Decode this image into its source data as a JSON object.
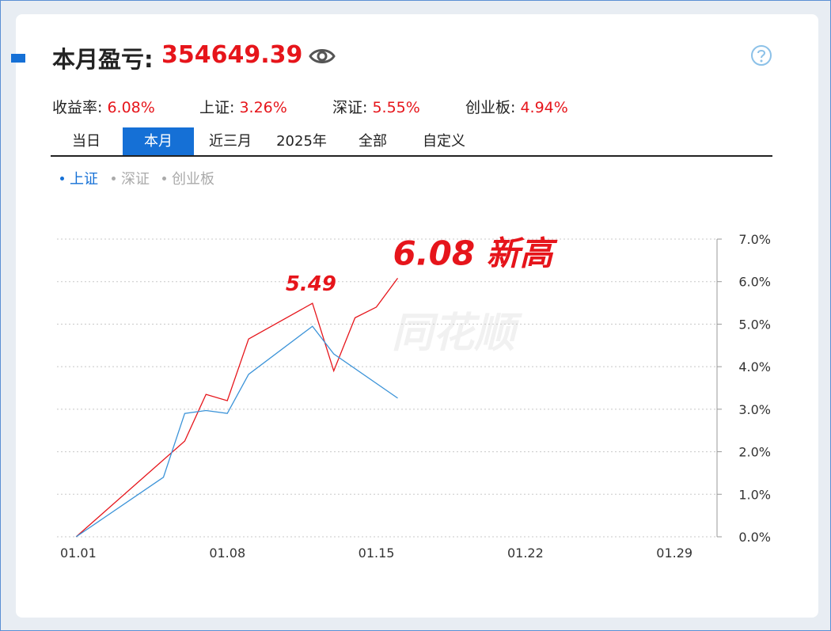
{
  "header": {
    "title_label": "本月盈亏:",
    "title_value": "354649.39"
  },
  "stats": [
    {
      "label": "收益率:",
      "value": "6.08%"
    },
    {
      "label": "上证:",
      "value": "3.26%"
    },
    {
      "label": "深证:",
      "value": "5.55%"
    },
    {
      "label": "创业板:",
      "value": "4.94%"
    }
  ],
  "tabs": [
    "当日",
    "本月",
    "近三月",
    "2025年",
    "全部",
    "自定义"
  ],
  "active_tab": "本月",
  "legend": [
    {
      "label": "上证",
      "active": true
    },
    {
      "label": "深证",
      "active": false
    },
    {
      "label": "创业板",
      "active": false
    }
  ],
  "watermark": "同花顺",
  "colors": {
    "accent": "#1570d6",
    "profit": "#e6151b",
    "series_account": "#e6151b",
    "series_index": "#3b93d8",
    "legend_inactive": "#aaaaaa"
  },
  "icons": {
    "visibility": "eye-icon",
    "help": "help-icon"
  },
  "chart_data": {
    "type": "line",
    "title": "",
    "xlabel": "",
    "ylabel": "",
    "x_range": [
      0,
      31
    ],
    "x_ticks": [
      {
        "day": 1,
        "label": "01.01"
      },
      {
        "day": 8,
        "label": "01.08"
      },
      {
        "day": 15,
        "label": "01.15"
      },
      {
        "day": 22,
        "label": "01.22"
      },
      {
        "day": 29,
        "label": "01.29"
      }
    ],
    "ylim": [
      0,
      7
    ],
    "y_ticks": [
      {
        "value": 0,
        "label": "0.0%"
      },
      {
        "value": 1,
        "label": "1.0%"
      },
      {
        "value": 2,
        "label": "2.0%"
      },
      {
        "value": 3,
        "label": "3.0%"
      },
      {
        "value": 4,
        "label": "4.0%"
      },
      {
        "value": 5,
        "label": "5.0%"
      },
      {
        "value": 6,
        "label": "6.0%"
      },
      {
        "value": 7,
        "label": "7.0%"
      }
    ],
    "grid": true,
    "y_axis_side": "right",
    "series": [
      {
        "key": "account",
        "points": [
          [
            0.9,
            0
          ],
          [
            6,
            2.25
          ],
          [
            7,
            3.35
          ],
          [
            8,
            3.2
          ],
          [
            9,
            4.65
          ],
          [
            12,
            5.49
          ],
          [
            13,
            3.9
          ],
          [
            14,
            5.15
          ],
          [
            15,
            5.4
          ],
          [
            16,
            6.08
          ]
        ]
      },
      {
        "name": "上证",
        "key": "index",
        "points": [
          [
            0.9,
            0
          ],
          [
            5,
            1.4
          ],
          [
            6,
            2.9
          ],
          [
            7,
            2.97
          ],
          [
            8,
            2.9
          ],
          [
            9,
            3.82
          ],
          [
            12,
            4.95
          ],
          [
            13,
            4.3
          ],
          [
            16,
            3.26
          ]
        ]
      }
    ],
    "annotations": [
      {
        "text": "5.49",
        "at": [
          12,
          5.49
        ],
        "size": "small"
      },
      {
        "text": "6.08 新高",
        "at": [
          16,
          6.08
        ],
        "size": "large"
      }
    ]
  }
}
